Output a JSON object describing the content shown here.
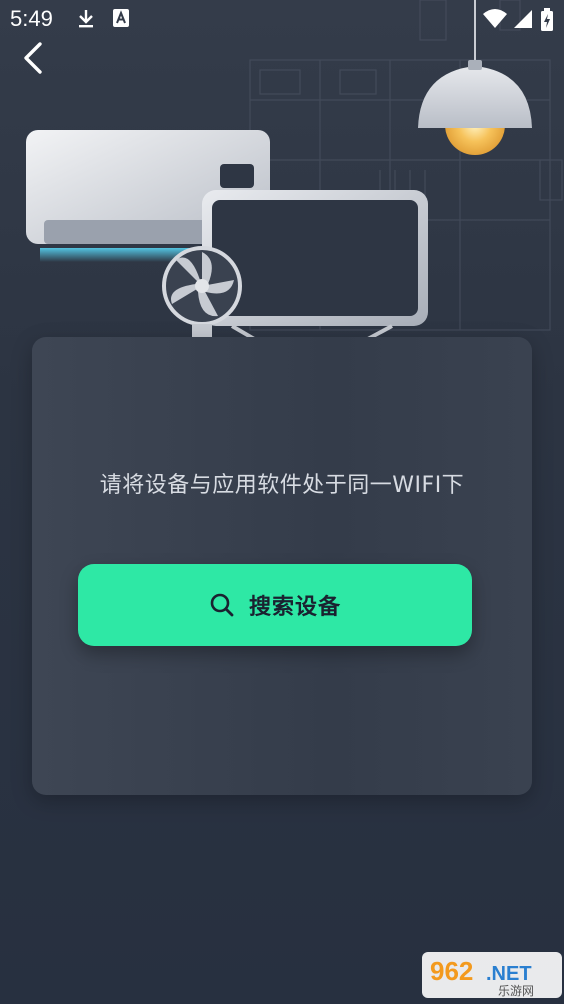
{
  "status_bar": {
    "time": "5:49",
    "icons": [
      "download-icon",
      "a11y-icon",
      "wifi-icon",
      "signal-icon",
      "battery-charging-icon"
    ]
  },
  "nav": {
    "back_icon": "chevron-left-icon"
  },
  "card": {
    "hint": "请将设备与应用软件处于同一WIFI下",
    "search_button_label": "搜索设备",
    "search_button_icon": "search-icon"
  },
  "colors": {
    "background": "#2c3442",
    "card": "#3a4250",
    "accent": "#2ee8a5",
    "button_text": "#1a2230"
  },
  "watermark": {
    "brand": "962.NET",
    "subtitle": "乐游网"
  }
}
